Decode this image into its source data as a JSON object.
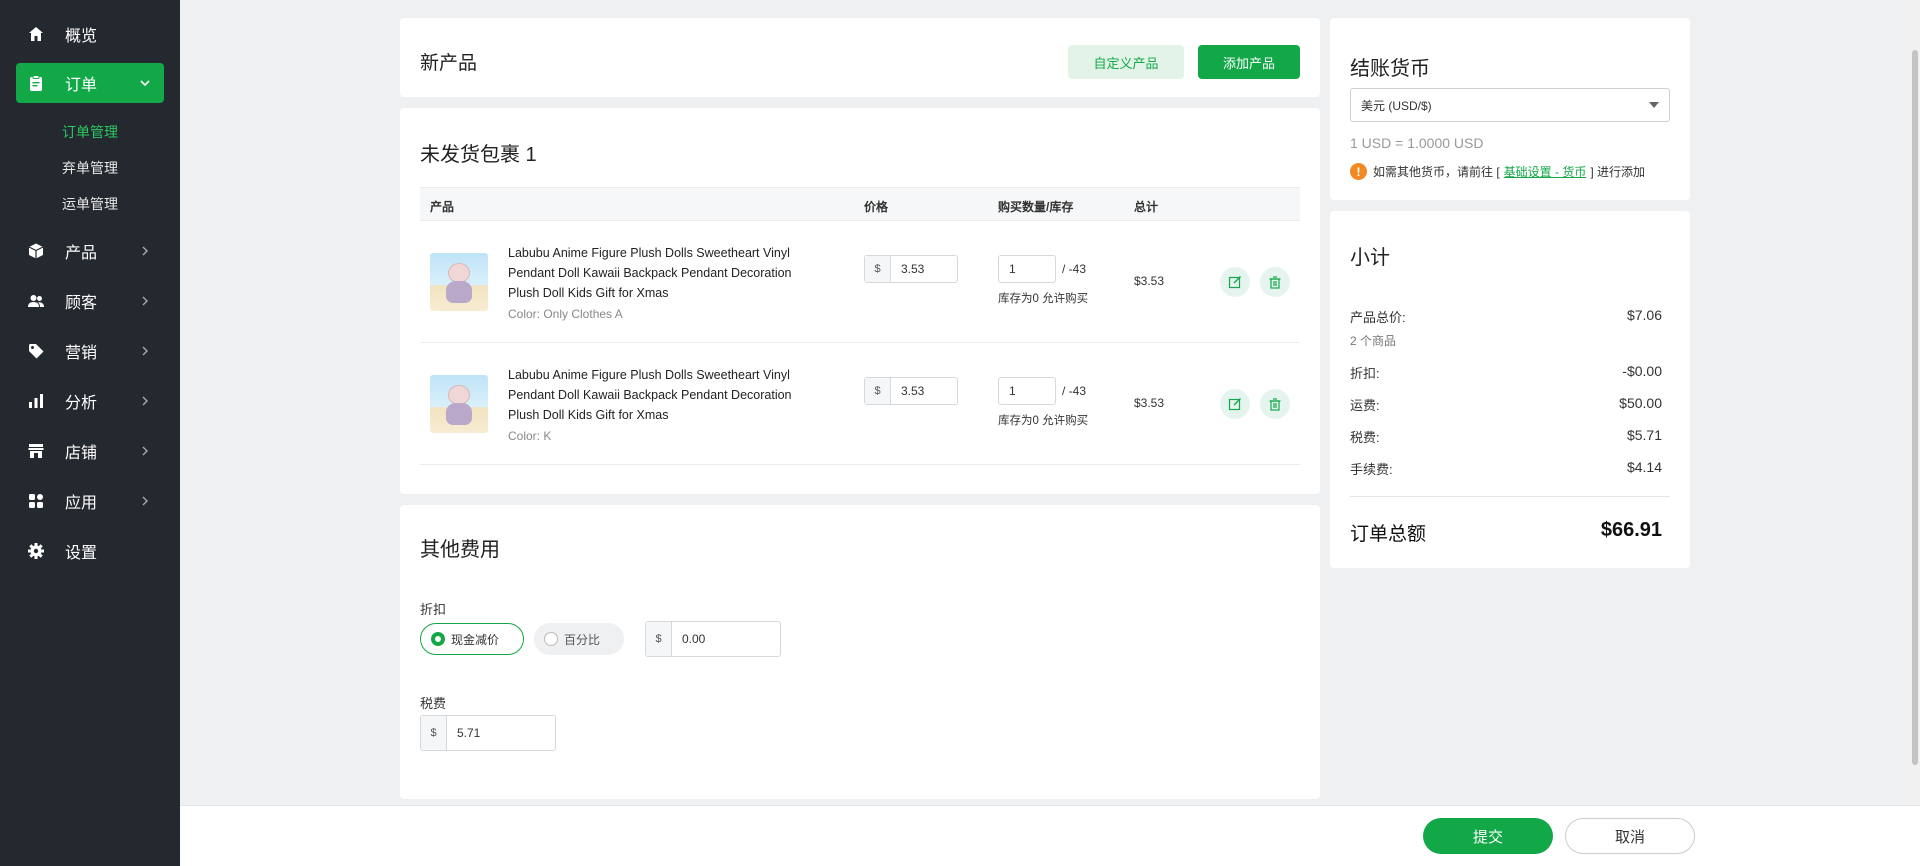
{
  "sidebar": {
    "items": [
      {
        "label": "概览",
        "icon": "home-icon"
      },
      {
        "label": "订单",
        "icon": "clipboard-icon"
      },
      {
        "label": "产品",
        "icon": "box-icon"
      },
      {
        "label": "顾客",
        "icon": "users-icon"
      },
      {
        "label": "营销",
        "icon": "tag-icon"
      },
      {
        "label": "分析",
        "icon": "bar-chart-icon"
      },
      {
        "label": "店铺",
        "icon": "store-icon"
      },
      {
        "label": "应用",
        "icon": "apps-icon"
      },
      {
        "label": "设置",
        "icon": "gear-icon"
      }
    ],
    "order_sub": [
      "订单管理",
      "弃单管理",
      "运单管理"
    ]
  },
  "new_product": {
    "title": "新产品",
    "custom_button": "自定义产品",
    "add_button": "添加产品"
  },
  "package": {
    "title": "未发货包裹 1",
    "columns": [
      "产品",
      "价格",
      "购买数量/库存",
      "总计"
    ],
    "rows": [
      {
        "name": "Labubu Anime Figure Plush Dolls Sweetheart Vinyl Pendant Doll Kawaii Backpack Pendant Decoration Plush Doll Kids Gift for Xmas",
        "variant": "Color: Only Clothes A",
        "currency": "$",
        "price": "3.53",
        "qty": "1",
        "stock": "/ -43",
        "stock_note": "库存为0 允许购买",
        "total": "$3.53"
      },
      {
        "name": "Labubu Anime Figure Plush Dolls Sweetheart Vinyl Pendant Doll Kawaii Backpack Pendant Decoration Plush Doll Kids Gift for Xmas",
        "variant": "Color: K",
        "currency": "$",
        "price": "3.53",
        "qty": "1",
        "stock": "/ -43",
        "stock_note": "库存为0 允许购买",
        "total": "$3.53"
      }
    ]
  },
  "other_fees": {
    "title": "其他费用",
    "discount_label": "折扣",
    "radio_cash": "现金减价",
    "radio_percent": "百分比",
    "discount_currency": "$",
    "discount_value": "0.00",
    "tax_label": "税费",
    "tax_currency": "$",
    "tax_value": "5.71"
  },
  "checkout": {
    "title": "结账货币",
    "currency_selected": "美元 (USD/$)",
    "rate": "1 USD = 1.0000 USD",
    "note_prefix": "如需其他货币，请前往 [",
    "note_link": "基础设置 - 货币",
    "note_suffix": "] 进行添加"
  },
  "subtotal": {
    "title": "小计",
    "product_total_label": "产品总价:",
    "product_total_value": "$7.06",
    "items_count": "2 个商品",
    "discount_label": "折扣:",
    "discount_value": "-$0.00",
    "shipping_label": "运费:",
    "shipping_value": "$50.00",
    "tax_label": "税费:",
    "tax_value": "$5.71",
    "fee_label": "手续费:",
    "fee_value": "$4.14",
    "order_total_label": "订单总额",
    "order_total_value": "$66.91"
  },
  "footer": {
    "submit": "提交",
    "cancel": "取消"
  },
  "colors": {
    "brand_green": "#13a847",
    "sidebar_bg": "#24292f",
    "warning_orange": "#f08a24"
  }
}
